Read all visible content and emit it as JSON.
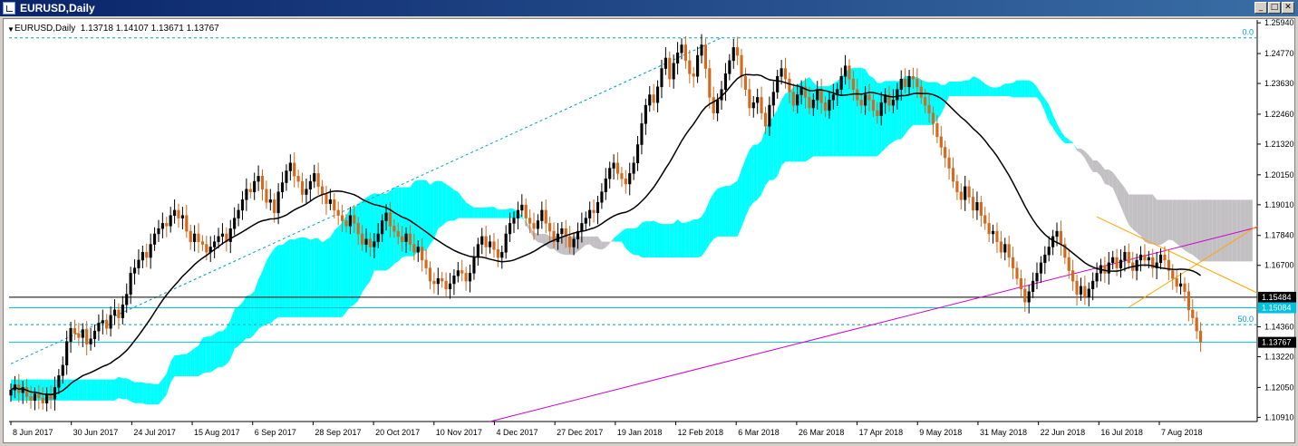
{
  "window": {
    "title": "EURUSD,Daily",
    "controls": [
      "minimize",
      "maximize",
      "close"
    ]
  },
  "header": {
    "symbol": "EURUSD,Daily",
    "ohlc": "1.13718 1.14107 1.13671 1.13767"
  },
  "colors": {
    "background": "#ffffff",
    "bull": "#000000",
    "bear": "#d2691e",
    "kumo_bear": "#c3c0c3",
    "kumo_bull": "#00ffff",
    "ma": "#000000",
    "channel": "#ffa500",
    "trendline": "#d000d0",
    "fib": "#00a0c0"
  },
  "chart_data": {
    "type": "candlestick",
    "title": "EURUSD,Daily",
    "ohlc_last": {
      "open": 1.13718,
      "high": 1.14107,
      "low": 1.13671,
      "close": 1.13767
    },
    "ylim": [
      1.1075,
      1.2605
    ],
    "y_ticks": [
      "1.25940",
      "1.24770",
      "1.23630",
      "1.22460",
      "1.21320",
      "1.20150",
      "1.19010",
      "1.17840",
      "1.16700",
      "1.14360",
      "1.13220",
      "1.12050",
      "1.10910"
    ],
    "x_ticks": [
      "8 Jun 2017",
      "30 Jun 2017",
      "24 Jul 2017",
      "15 Aug 2017",
      "6 Sep 2017",
      "28 Sep 2017",
      "20 Oct 2017",
      "10 Nov 2017",
      "4 Dec 2017",
      "27 Dec 2017",
      "19 Jan 2018",
      "12 Feb 2018",
      "6 Mar 2018",
      "26 Mar 2018",
      "17 Apr 2018",
      "9 May 2018",
      "31 May 2018",
      "22 Jun 2018",
      "16 Jul 2018",
      "7 Aug 2018"
    ],
    "price_labels": [
      {
        "text": "1.15484",
        "value": 1.15484,
        "style": "black"
      },
      {
        "text": "1.15084",
        "value": 1.15084,
        "style": "cyan"
      },
      {
        "text": "1.13767",
        "value": 1.13767,
        "style": "black"
      }
    ],
    "horizontal_lines": [
      {
        "value": 1.15484,
        "color": "#000000"
      },
      {
        "value": 1.15084,
        "color": "#00c0e0"
      },
      {
        "value": 1.13767,
        "color": "#00c0e0"
      }
    ],
    "fib_levels": [
      {
        "label": "0.0",
        "value": 1.2537
      },
      {
        "label": "50.0",
        "value": 1.1444
      }
    ],
    "close_series": [
      1.1195,
      1.1215,
      1.1185,
      1.1205,
      1.117,
      1.1155,
      1.118,
      1.1165,
      1.1145,
      1.118,
      1.116,
      1.1205,
      1.125,
      1.129,
      1.138,
      1.143,
      1.141,
      1.1395,
      1.1425,
      1.137,
      1.139,
      1.142,
      1.145,
      1.146,
      1.143,
      1.148,
      1.15,
      1.147,
      1.152,
      1.156,
      1.164,
      1.166,
      1.169,
      1.172,
      1.17,
      1.175,
      1.179,
      1.181,
      1.183,
      1.182,
      1.186,
      1.188,
      1.185,
      1.186,
      1.18,
      1.176,
      1.179,
      1.176,
      1.175,
      1.172,
      1.174,
      1.176,
      1.178,
      1.179,
      1.176,
      1.181,
      1.185,
      1.188,
      1.192,
      1.196,
      1.195,
      1.199,
      1.201,
      1.196,
      1.191,
      1.192,
      1.187,
      1.195,
      1.1985,
      1.203,
      1.206,
      1.201,
      1.199,
      1.194,
      1.196,
      1.199,
      1.202,
      1.197,
      1.194,
      1.1905,
      1.192,
      1.188,
      1.186,
      1.184,
      1.182,
      1.186,
      1.183,
      1.179,
      1.175,
      1.177,
      1.174,
      1.176,
      1.179,
      1.184,
      1.187,
      1.182,
      1.18,
      1.178,
      1.176,
      1.179,
      1.175,
      1.172,
      1.174,
      1.169,
      1.166,
      1.161,
      1.16,
      1.162,
      1.161,
      1.158,
      1.16,
      1.163,
      1.165,
      1.164,
      1.161,
      1.164,
      1.17,
      1.175,
      1.178,
      1.174,
      1.176,
      1.173,
      1.17,
      1.172,
      1.179,
      1.183,
      1.185,
      1.188,
      1.19,
      1.185,
      1.183,
      1.181,
      1.184,
      1.188,
      1.183,
      1.18,
      1.176,
      1.179,
      1.181,
      1.178,
      1.174,
      1.177,
      1.18,
      1.183,
      1.185,
      1.188,
      1.187,
      1.191,
      1.195,
      1.2,
      1.204,
      1.206,
      1.202,
      1.2,
      1.198,
      1.202,
      1.206,
      1.213,
      1.221,
      1.228,
      1.232,
      1.229,
      1.235,
      1.242,
      1.246,
      1.238,
      1.244,
      1.248,
      1.251,
      1.245,
      1.24,
      1.239,
      1.247,
      1.251,
      1.242,
      1.231,
      1.225,
      1.23,
      1.234,
      1.24,
      1.245,
      1.25,
      1.247,
      1.239,
      1.234,
      1.227,
      1.229,
      1.231,
      1.225,
      1.22,
      1.228,
      1.233,
      1.239,
      1.242,
      1.238,
      1.233,
      1.228,
      1.232,
      1.235,
      1.231,
      1.227,
      1.23,
      1.234,
      1.229,
      1.226,
      1.23,
      1.232,
      1.234,
      1.239,
      1.243,
      1.238,
      1.234,
      1.23,
      1.228,
      1.232,
      1.23,
      1.226,
      1.224,
      1.229,
      1.232,
      1.228,
      1.23,
      1.234,
      1.238,
      1.235,
      1.239,
      1.238,
      1.235,
      1.231,
      1.228,
      1.225,
      1.221,
      1.216,
      1.212,
      1.208,
      1.204,
      1.199,
      1.195,
      1.192,
      1.197,
      1.193,
      1.188,
      1.191,
      1.186,
      1.183,
      1.179,
      1.18,
      1.176,
      1.172,
      1.175,
      1.17,
      1.166,
      1.162,
      1.158,
      1.153,
      1.157,
      1.161,
      1.164,
      1.168,
      1.171,
      1.174,
      1.178,
      1.18,
      1.175,
      1.17,
      1.165,
      1.161,
      1.156,
      1.159,
      1.155,
      1.158,
      1.161,
      1.164,
      1.167,
      1.164,
      1.168,
      1.17,
      1.166,
      1.169,
      1.172,
      1.168,
      1.165,
      1.169,
      1.171,
      1.169,
      1.17,
      1.166,
      1.168,
      1.171,
      1.169,
      1.165,
      1.162,
      1.159,
      1.16,
      1.157,
      1.15,
      1.147,
      1.142,
      1.1377
    ],
    "moving_average": {
      "color": "#000000",
      "period": 26
    },
    "ichimoku": {
      "kumo_bear_color": "#c3c0c3",
      "kumo_bull_color": "#00ffff"
    },
    "trendlines": [
      "rising support (magenta)",
      "descending wedge channel (orange)",
      "Fibonacci fan (dashed cyan)"
    ]
  }
}
